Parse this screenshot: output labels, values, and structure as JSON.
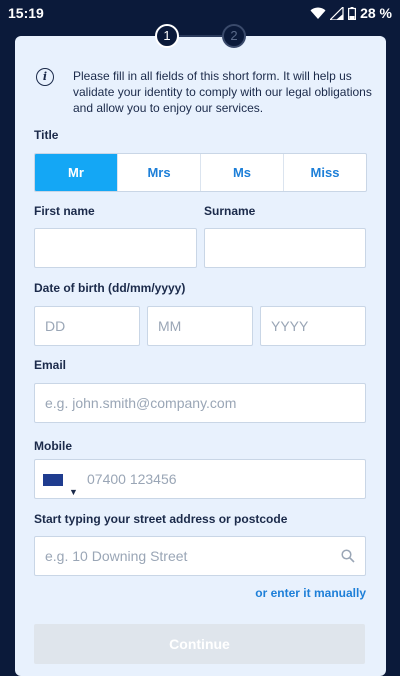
{
  "status_bar": {
    "time": "15:19",
    "battery": "28 %"
  },
  "stepper": {
    "steps": [
      "1",
      "2"
    ],
    "active": 1
  },
  "info": {
    "text": "Please fill in all fields of this short form. It will help us validate your identity to comply with our legal obligations and allow you to enjoy our services."
  },
  "title": {
    "label": "Title",
    "options": [
      "Mr",
      "Mrs",
      "Ms",
      "Miss"
    ],
    "selected": "Mr"
  },
  "first_name": {
    "label": "First name",
    "value": ""
  },
  "surname": {
    "label": "Surname",
    "value": ""
  },
  "dob": {
    "label": "Date of birth (dd/mm/yyyy)",
    "day_placeholder": "DD",
    "month_placeholder": "MM",
    "year_placeholder": "YYYY"
  },
  "email": {
    "label": "Email",
    "placeholder": "e.g. john.smith@company.com"
  },
  "mobile": {
    "label": "Mobile",
    "placeholder": "07400 123456",
    "country_flag": "uk-flag-icon"
  },
  "address": {
    "label": "Start typing your street address or postcode",
    "placeholder": "e.g. 10 Downing Street",
    "manual_link": "or enter it manually"
  },
  "continue_button": {
    "label": "Continue"
  },
  "colors": {
    "background": "#0b1a3a",
    "card": "#e8f1fd",
    "accent": "#14a7f5",
    "link": "#1d7fd8"
  }
}
